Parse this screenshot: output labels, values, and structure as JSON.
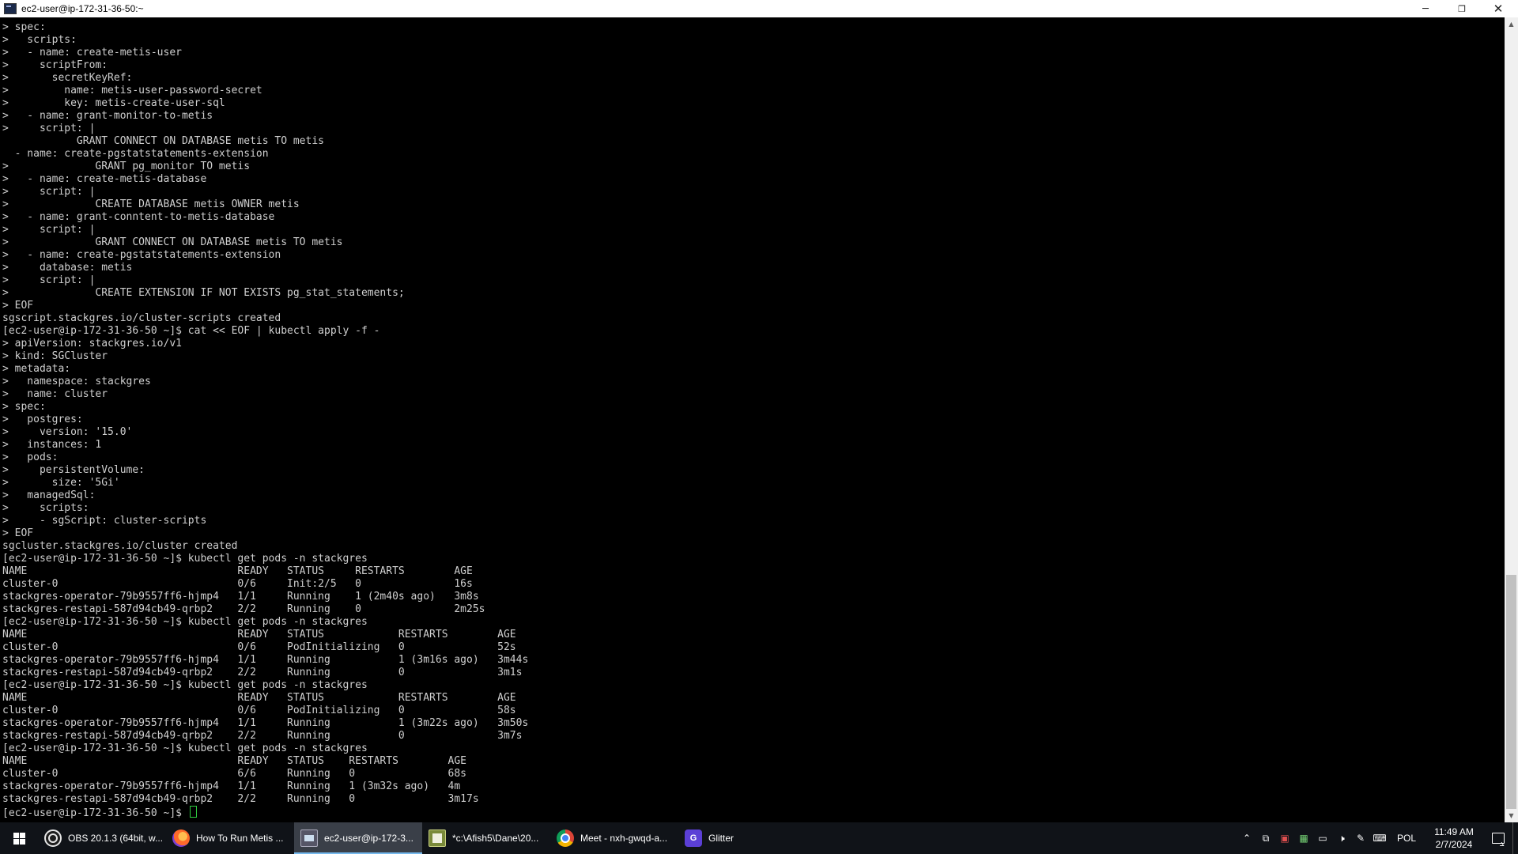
{
  "window": {
    "title": "ec2-user@ip-172-31-36-50:~",
    "controls": {
      "minimize": "─",
      "restore": "❐",
      "close": "✕"
    }
  },
  "terminal": {
    "lines": [
      "> spec:",
      ">   scripts:",
      ">   - name: create-metis-user",
      ">     scriptFrom:",
      ">       secretKeyRef:",
      ">         name: metis-user-password-secret",
      ">         key: metis-create-user-sql",
      ">   - name: grant-monitor-to-metis",
      ">     script: |",
      "            GRANT CONNECT ON DATABASE metis TO metis",
      "  - name: create-pgstatstatements-extension",
      ">              GRANT pg_monitor TO metis",
      ">   - name: create-metis-database",
      ">     script: |",
      ">              CREATE DATABASE metis OWNER metis",
      ">   - name: grant-conntent-to-metis-database",
      ">     script: |",
      ">              GRANT CONNECT ON DATABASE metis TO metis",
      ">   - name: create-pgstatstatements-extension",
      ">     database: metis",
      ">     script: |",
      ">              CREATE EXTENSION IF NOT EXISTS pg_stat_statements;",
      "> EOF",
      "sgscript.stackgres.io/cluster-scripts created",
      "[ec2-user@ip-172-31-36-50 ~]$ cat << EOF | kubectl apply -f -",
      "> apiVersion: stackgres.io/v1",
      "> kind: SGCluster",
      "> metadata:",
      ">   namespace: stackgres",
      ">   name: cluster",
      "> spec:",
      ">   postgres:",
      ">     version: '15.0'",
      ">   instances: 1",
      ">   pods:",
      ">     persistentVolume:",
      ">       size: '5Gi'",
      ">   managedSql:",
      ">     scripts:",
      ">     - sgScript: cluster-scripts",
      "> EOF",
      "sgcluster.stackgres.io/cluster created",
      "[ec2-user@ip-172-31-36-50 ~]$ kubectl get pods -n stackgres",
      "NAME                                  READY   STATUS     RESTARTS        AGE",
      "cluster-0                             0/6     Init:2/5   0               16s",
      "stackgres-operator-79b9557ff6-hjmp4   1/1     Running    1 (2m40s ago)   3m8s",
      "stackgres-restapi-587d94cb49-qrbp2    2/2     Running    0               2m25s",
      "[ec2-user@ip-172-31-36-50 ~]$ kubectl get pods -n stackgres",
      "NAME                                  READY   STATUS            RESTARTS        AGE",
      "cluster-0                             0/6     PodInitializing   0               52s",
      "stackgres-operator-79b9557ff6-hjmp4   1/1     Running           1 (3m16s ago)   3m44s",
      "stackgres-restapi-587d94cb49-qrbp2    2/2     Running           0               3m1s",
      "[ec2-user@ip-172-31-36-50 ~]$ kubectl get pods -n stackgres",
      "NAME                                  READY   STATUS            RESTARTS        AGE",
      "cluster-0                             0/6     PodInitializing   0               58s",
      "stackgres-operator-79b9557ff6-hjmp4   1/1     Running           1 (3m22s ago)   3m50s",
      "stackgres-restapi-587d94cb49-qrbp2    2/2     Running           0               3m7s",
      "[ec2-user@ip-172-31-36-50 ~]$ kubectl get pods -n stackgres",
      "NAME                                  READY   STATUS    RESTARTS        AGE",
      "cluster-0                             6/6     Running   0               68s",
      "stackgres-operator-79b9557ff6-hjmp4   1/1     Running   1 (3m32s ago)   4m",
      "stackgres-restapi-587d94cb49-qrbp2    2/2     Running   0               3m17s"
    ],
    "prompt": "[ec2-user@ip-172-31-36-50 ~]$ "
  },
  "taskbar": {
    "items": [
      {
        "label": "OBS 20.1.3 (64bit, w...",
        "icon": "obs-icon",
        "active": false,
        "running": true
      },
      {
        "label": "How To Run Metis ...",
        "icon": "firefox-icon",
        "active": false,
        "running": true
      },
      {
        "label": "ec2-user@ip-172-3...",
        "icon": "putty-icon",
        "active": true,
        "running": true
      },
      {
        "label": "*c:\\Afish5\\Dane\\20...",
        "icon": "notepad-icon",
        "active": false,
        "running": true
      },
      {
        "label": "Meet - nxh-gwqd-a...",
        "icon": "chrome-icon",
        "active": false,
        "running": true
      },
      {
        "label": "Glitter",
        "icon": "glitter-icon",
        "active": false,
        "running": true
      }
    ],
    "tray": {
      "language": "POL",
      "time": "11:49 AM",
      "date": "2/7/2024"
    }
  },
  "colors": {
    "terminal_bg": "#000000",
    "terminal_fg": "#cfcfcf",
    "cursor": "#2ecc40",
    "taskbar_bg": "#101318",
    "taskbar_active": "#3a3f48",
    "taskbar_underline": "#76b9ed"
  }
}
